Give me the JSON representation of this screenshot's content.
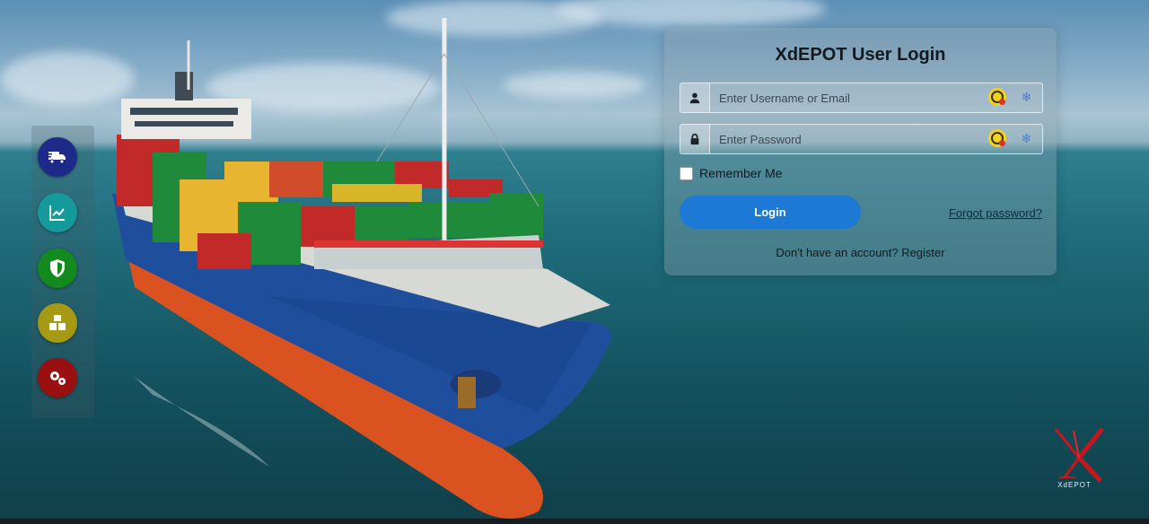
{
  "card": {
    "title": "XdEPOT User Login",
    "username_placeholder": "Enter Username or Email",
    "password_placeholder": "Enter Password",
    "remember_label": "Remember Me",
    "login_label": "Login",
    "forgot_label": "Forgot password?",
    "register_text": "Don't have an account? Register"
  },
  "sidebar": {
    "items": [
      {
        "icon": "truck-icon",
        "color": "#1e2a8a"
      },
      {
        "icon": "chart-line-icon",
        "color": "#159a9c"
      },
      {
        "icon": "shield-icon",
        "color": "#138a1e"
      },
      {
        "icon": "boxes-icon",
        "color": "#a69a14"
      },
      {
        "icon": "gears-icon",
        "color": "#9a0f0f"
      }
    ]
  },
  "logo": {
    "text": "XdEPOT"
  }
}
